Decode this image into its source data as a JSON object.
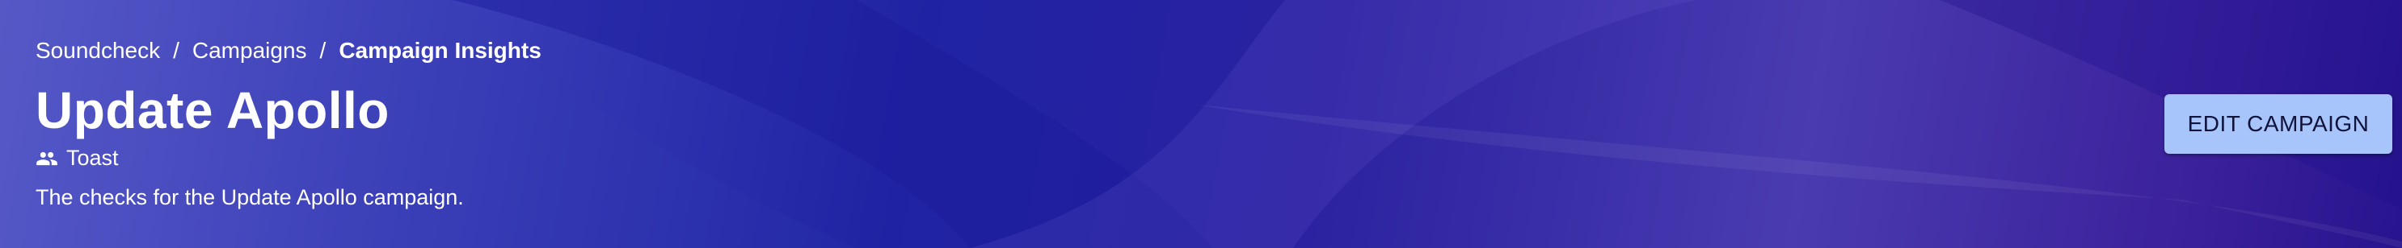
{
  "breadcrumb": {
    "items": [
      "Soundcheck",
      "Campaigns"
    ],
    "separator": "/",
    "current": "Campaign Insights"
  },
  "page": {
    "title": "Update Apollo",
    "owner": "Toast",
    "owner_icon": "group-icon",
    "description": "The checks for the Update Apollo campaign."
  },
  "actions": {
    "edit_label": "EDIT CAMPAIGN"
  },
  "colors": {
    "banner_gradient": [
      "#5a5cc9",
      "#1f23a3",
      "#4a3bb0",
      "#27148e"
    ],
    "button_bg": "#a7c4fb",
    "button_text": "#10133a",
    "text": "#ffffff"
  }
}
